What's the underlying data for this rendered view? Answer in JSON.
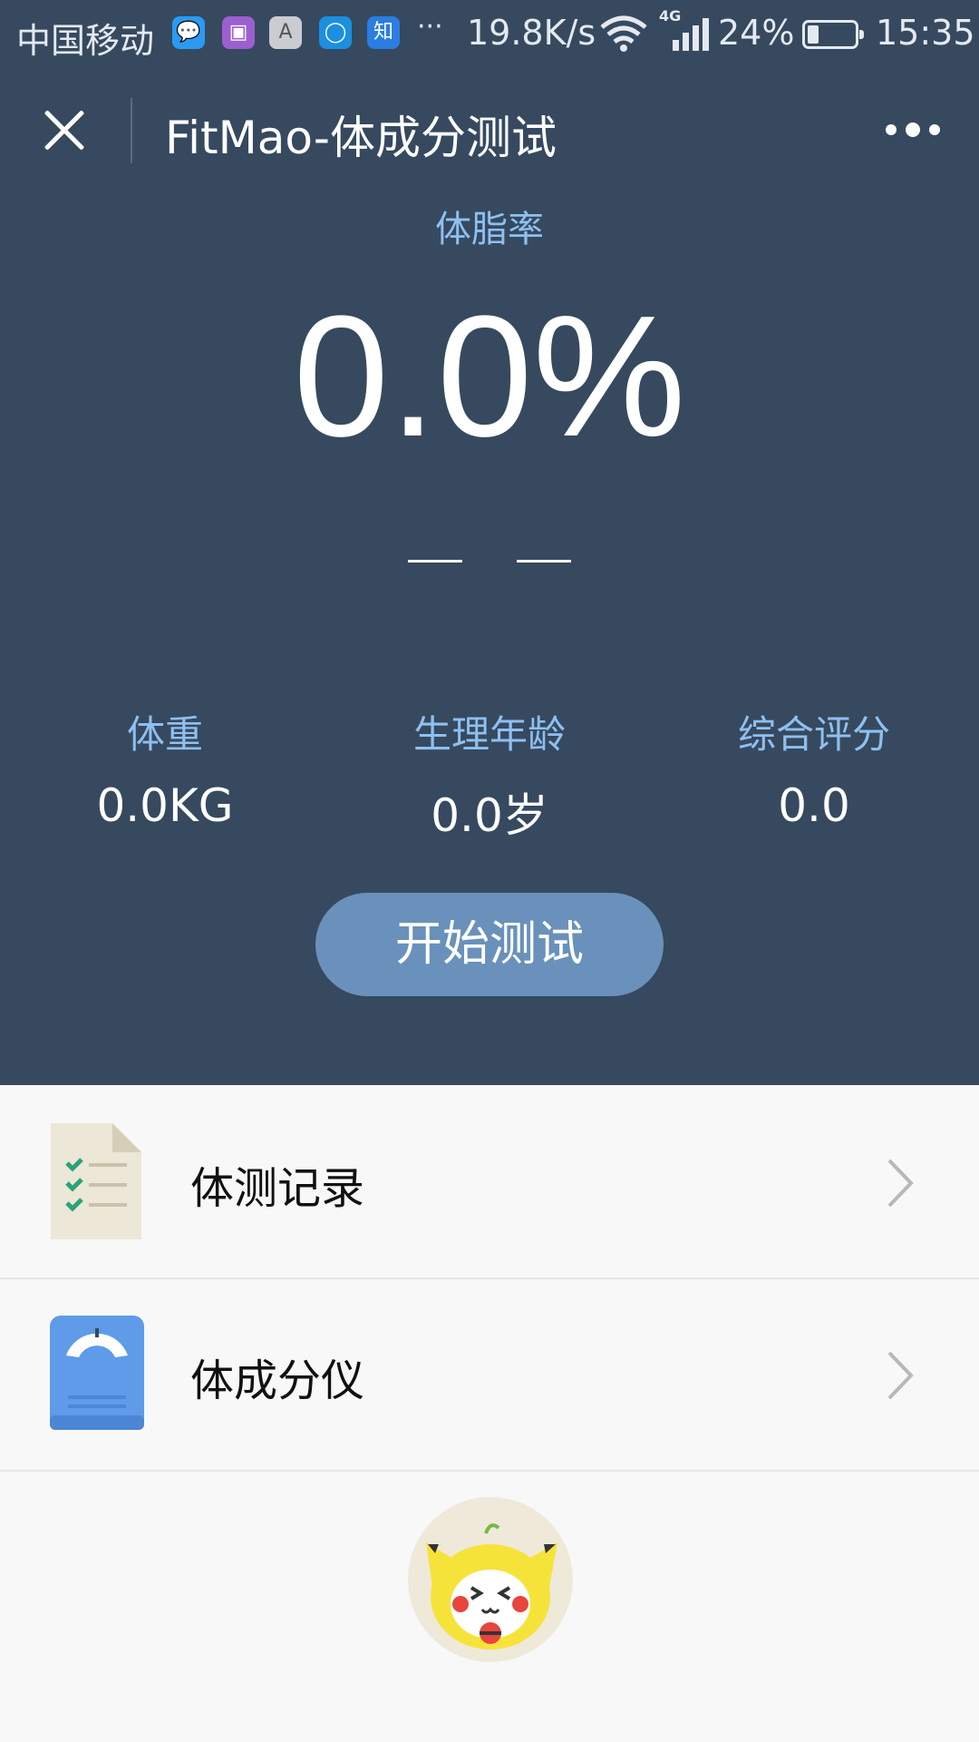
{
  "status_bar": {
    "carrier": "中国移动",
    "notif_icons": [
      "message-icon",
      "gallery-icon",
      "font-icon",
      "cloud-icon",
      "zhihu-icon"
    ],
    "zhihu_glyph": "知",
    "font_glyph": "A",
    "more": "···",
    "speed": "19.8K/s",
    "network": "4G",
    "battery": "24%",
    "battery_level": 0.24,
    "time": "15:35"
  },
  "nav": {
    "title": "FitMao-体成分测试"
  },
  "metrics": {
    "body_fat_label": "体脂率",
    "body_fat_value": "0.0%",
    "stats": [
      {
        "label": "体重",
        "value": "0.0KG"
      },
      {
        "label": "生理年龄",
        "value": "0.0岁"
      },
      {
        "label": "综合评分",
        "value": "0.0"
      }
    ]
  },
  "start_button": "开始测试",
  "menu": [
    {
      "label": "体测记录",
      "icon": "document-checklist-icon"
    },
    {
      "label": "体成分仪",
      "icon": "scale-icon"
    }
  ],
  "colors": {
    "header_bg": "#36495f",
    "accent_label": "#8ec0f0",
    "button_bg": "#6991bb",
    "page_bg": "#f8f8f8"
  }
}
